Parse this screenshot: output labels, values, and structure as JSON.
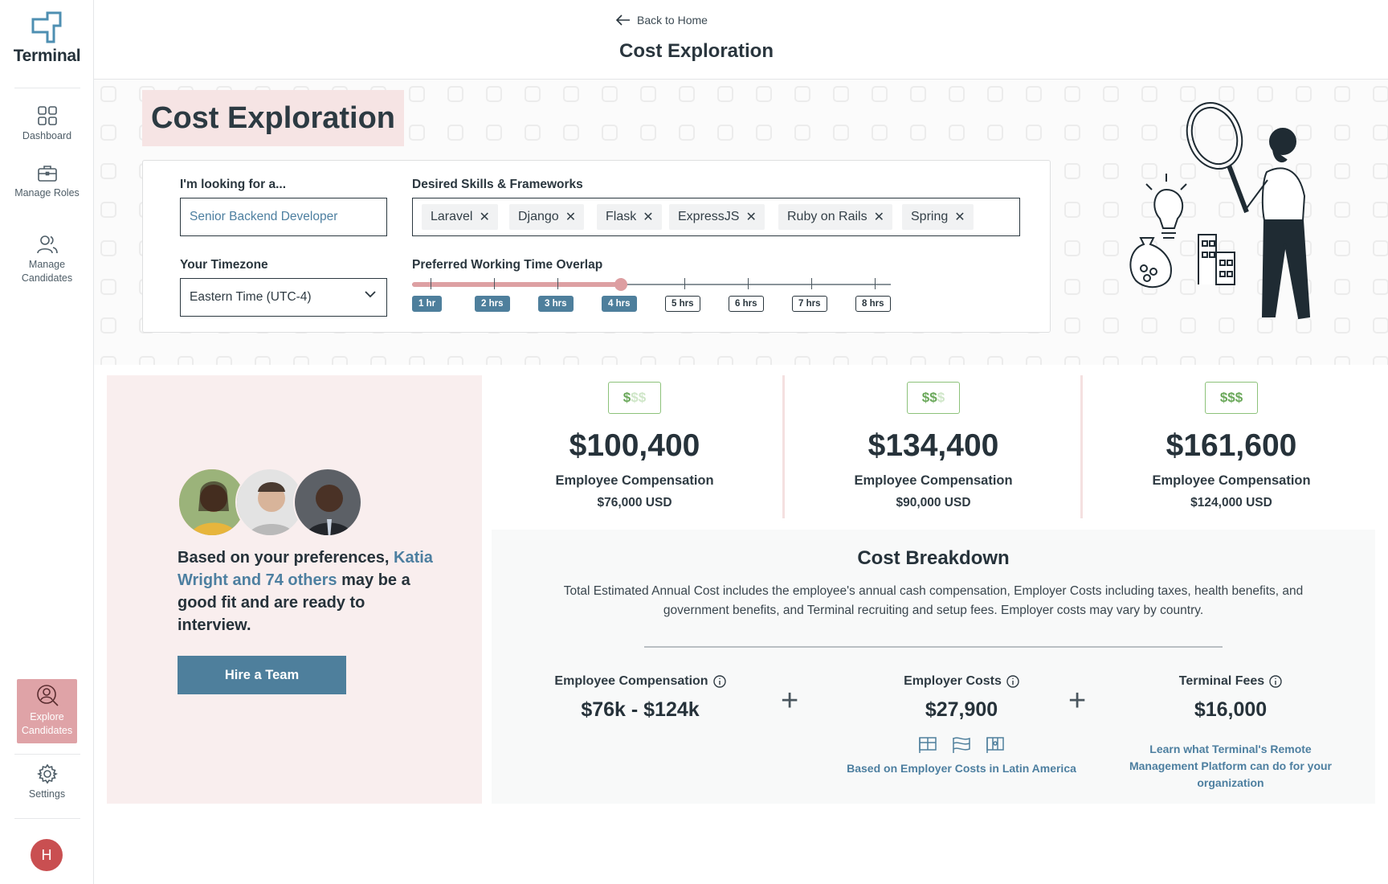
{
  "app": {
    "name": "Terminal"
  },
  "sidebar": {
    "items": [
      {
        "label": "Dashboard",
        "icon": "grid-icon"
      },
      {
        "label": "Manage Roles",
        "icon": "briefcase-icon"
      },
      {
        "label": "Manage Candidates",
        "icon": "users-icon"
      },
      {
        "label": "Explore Candidates",
        "icon": "person-search-icon",
        "active": true
      },
      {
        "label": "Settings",
        "icon": "gear-icon"
      }
    ],
    "avatar_initial": "H"
  },
  "header": {
    "back_label": "Back to Home",
    "title": "Cost Exploration"
  },
  "hero": {
    "title": "Cost Exploration",
    "role_label": "I'm looking for a...",
    "role_value": "Senior Backend Developer",
    "skills_label": "Desired Skills & Frameworks",
    "skills": [
      "Laravel",
      "Django",
      "Flask",
      "ExpressJS",
      "Ruby on Rails",
      "Spring"
    ],
    "timezone_label": "Your Timezone",
    "timezone_value": "Eastern Time (UTC-4)",
    "overlap_label": "Preferred Working Time Overlap",
    "overlap_options": [
      "1 hr",
      "2 hrs",
      "3 hrs",
      "4 hrs",
      "5 hrs",
      "6 hrs",
      "7 hrs",
      "8 hrs"
    ],
    "overlap_selected_hours": 4
  },
  "candidates": {
    "text_before": "Based on your preferences,",
    "link_text": "Katia Wright and 74 others",
    "text_after": "may be a good fit and are ready to interview.",
    "button": "Hire a Team"
  },
  "tiers": [
    {
      "badge": "$$$",
      "level": 1,
      "amount": "$100,400",
      "label": "Employee Compensation",
      "usd": "$76,000 USD"
    },
    {
      "badge": "$$$",
      "level": 2,
      "amount": "$134,400",
      "label": "Employee Compensation",
      "usd": "$90,000 USD"
    },
    {
      "badge": "$$$",
      "level": 3,
      "amount": "$161,600",
      "label": "Employee Compensation",
      "usd": "$124,000 USD"
    }
  ],
  "breakdown": {
    "title": "Cost Breakdown",
    "description": "Total Estimated Annual Cost includes the employee's annual cash compensation, Employer Costs including taxes, health benefits, and government benefits, and Terminal recruiting and setup fees. Employer costs may vary by country.",
    "employee": {
      "label": "Employee Compensation",
      "value": "$76k - $124k"
    },
    "employer": {
      "label": "Employer Costs",
      "value": "$27,900",
      "note": "Based on Employer Costs in Latin America"
    },
    "terminal": {
      "label": "Terminal Fees",
      "value": "$16,000",
      "note": "Learn what Terminal's Remote Management Platform can do for your organization"
    }
  },
  "colors": {
    "accent": "#4e7f9c",
    "pink": "#dfa3a7",
    "green": "#6aa85a"
  }
}
